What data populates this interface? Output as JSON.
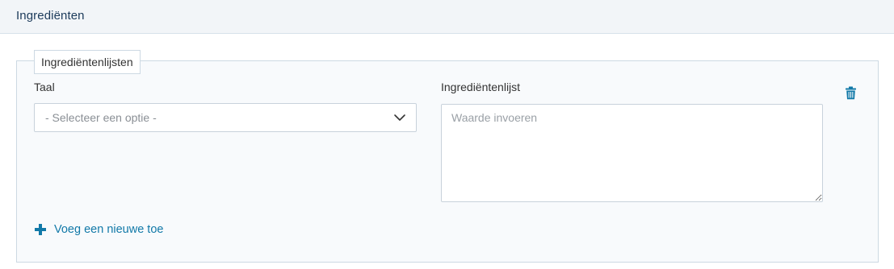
{
  "section": {
    "title": "Ingrediënten"
  },
  "fieldset": {
    "legend": "Ingrediëntenlijsten"
  },
  "fields": {
    "language": {
      "label": "Taal",
      "selected": "- Selecteer een optie -",
      "icon": "chevron-down-icon"
    },
    "ingredient_list": {
      "label": "Ingrediëntenlijst",
      "value": "",
      "placeholder": "Waarde invoeren"
    }
  },
  "actions": {
    "delete_icon": "trash-icon",
    "add_label": "Voeg een nieuwe toe",
    "add_icon": "plus-icon"
  },
  "colors": {
    "accent": "#1279a8",
    "header_bg": "#f2f5f8",
    "panel_bg": "#f8fafc"
  }
}
